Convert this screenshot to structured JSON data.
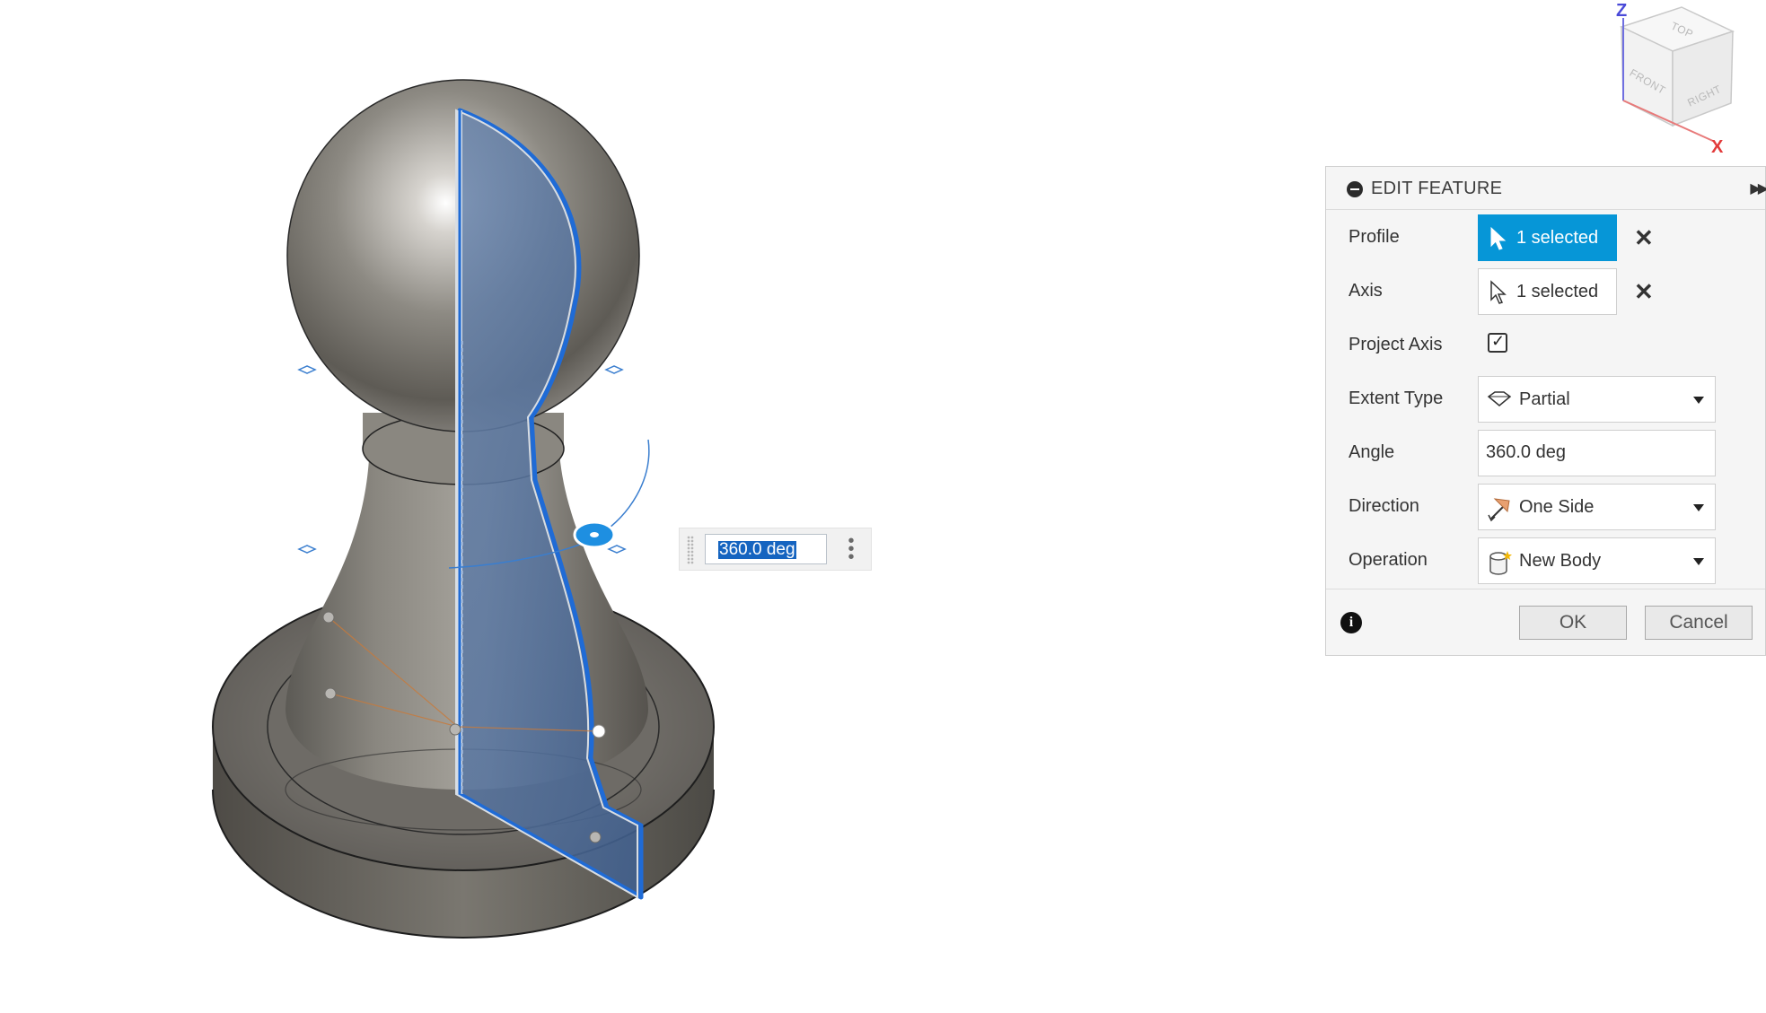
{
  "canvas": {
    "inline_angle_value": "360.0 deg"
  },
  "view_cube": {
    "face_top": "TOP",
    "face_front": "FRONT",
    "face_right": "RIGHT",
    "axis_z": "Z",
    "axis_x": "X",
    "colors": {
      "z_axis": "#4a4ad8",
      "x_axis": "#e23a3a"
    }
  },
  "edit_feature": {
    "title": "EDIT FEATURE",
    "rows": {
      "profile": {
        "label": "Profile",
        "value": "1 selected",
        "active": true
      },
      "axis": {
        "label": "Axis",
        "value": "1 selected",
        "active": false
      },
      "project_axis": {
        "label": "Project Axis",
        "checked": true
      },
      "extent_type": {
        "label": "Extent Type",
        "value": "Partial"
      },
      "angle": {
        "label": "Angle",
        "value": "360.0 deg"
      },
      "direction": {
        "label": "Direction",
        "value": "One Side"
      },
      "operation": {
        "label": "Operation",
        "value": "New Body"
      }
    },
    "ok_label": "OK",
    "cancel_label": "Cancel",
    "colors": {
      "accent": "#0696d7",
      "selection": "#1564c0"
    }
  }
}
